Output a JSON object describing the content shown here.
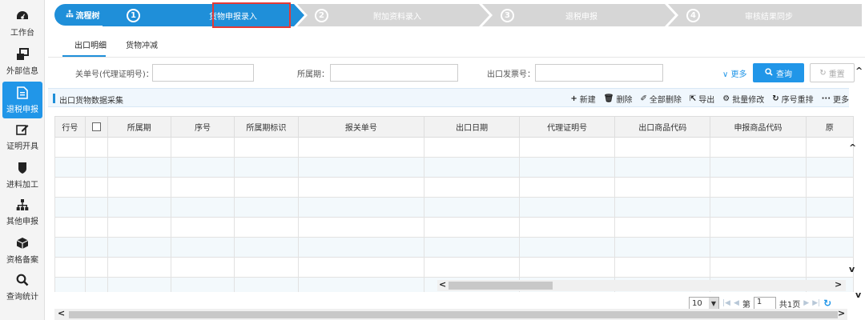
{
  "sidebar": {
    "items": [
      {
        "label": "工作台",
        "icon": "dashboard-icon"
      },
      {
        "label": "外部信息",
        "icon": "windows-icon"
      },
      {
        "label": "退税申报",
        "icon": "document-icon",
        "active": true
      },
      {
        "label": "证明开具",
        "icon": "edit-icon"
      },
      {
        "label": "进料加工",
        "icon": "shield-icon"
      },
      {
        "label": "其他申报",
        "icon": "sitemap-icon"
      },
      {
        "label": "资格备案",
        "icon": "cube-icon"
      },
      {
        "label": "查询统计",
        "icon": "search-icon"
      }
    ]
  },
  "steps": {
    "flow_label": "流程树",
    "items": [
      {
        "num": "1",
        "label": "货物申报录入",
        "active": true
      },
      {
        "num": "2",
        "label": "附加资料录入",
        "active": false
      },
      {
        "num": "3",
        "label": "退税申报",
        "active": false
      },
      {
        "num": "4",
        "label": "审核结果同步",
        "active": false
      }
    ]
  },
  "tabs": [
    {
      "label": "出口明细",
      "active": true
    },
    {
      "label": "货物冲减",
      "active": false
    }
  ],
  "search": {
    "customs_label": "关单号(代理证明号)：",
    "period_label": "所属期：",
    "invoice_label": "出口发票号：",
    "more_label": "更多",
    "query_label": "查询",
    "reset_label": "重置"
  },
  "panel": {
    "title": "出口货物数据采集",
    "tools": [
      {
        "glyph": "+",
        "label": "新建",
        "icon": "plus-icon"
      },
      {
        "glyph": "🗑",
        "label": "删除",
        "icon": "trash-icon"
      },
      {
        "glyph": "✐",
        "label": "全部删除",
        "icon": "eraser-icon"
      },
      {
        "glyph": "⇱",
        "label": "导出",
        "icon": "export-icon"
      },
      {
        "glyph": "⚙",
        "label": "批量修改",
        "icon": "cogs-icon"
      },
      {
        "glyph": "↻",
        "label": "序号重排",
        "icon": "refresh-icon"
      },
      {
        "glyph": "···",
        "label": "更多",
        "icon": "ellipsis-icon"
      }
    ]
  },
  "table": {
    "columns": [
      "行号",
      "",
      "所属期",
      "序号",
      "所属期标识",
      "报关单号",
      "出口日期",
      "代理证明号",
      "出口商品代码",
      "申报商品代码",
      "原"
    ]
  },
  "pager": {
    "page_size": "10",
    "page_prefix": "第",
    "page_value": "1",
    "total_pages": "共1页"
  },
  "colors": {
    "accent": "#2196e8",
    "step_inactive": "#d6d6d6",
    "highlight": "#e53935"
  }
}
